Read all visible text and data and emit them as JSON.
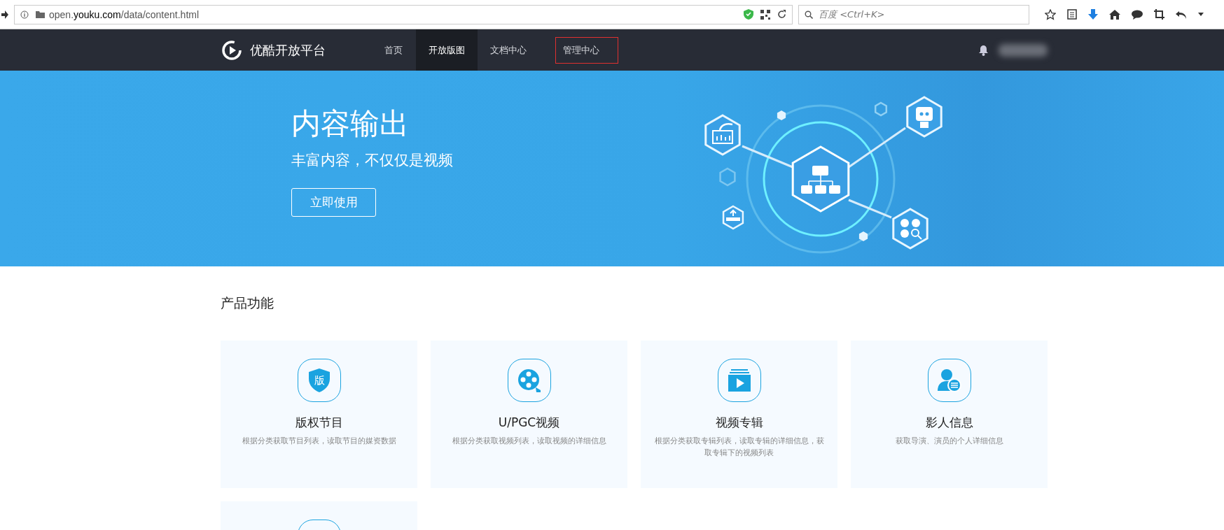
{
  "browser": {
    "url_host_prefix": "open.",
    "url_host": "youku.com",
    "url_path": "/data/content.html",
    "search_placeholder": "百度 <Ctrl+K>"
  },
  "nav": {
    "logo": "优酷开放平台",
    "items": [
      {
        "label": "首页",
        "selected": false,
        "annotated": false
      },
      {
        "label": "开放版图",
        "selected": true,
        "annotated": false
      },
      {
        "label": "文档中心",
        "selected": false,
        "annotated": false
      },
      {
        "label": "管理中心",
        "selected": false,
        "annotated": true
      }
    ]
  },
  "hero": {
    "title": "内容输出",
    "subtitle": "丰富内容，不仅仅是视频",
    "button": "立即使用"
  },
  "section_title": "产品功能",
  "cards": [
    {
      "kind": "shield",
      "icon_text": "版",
      "title": "版权节目",
      "description": "根据分类获取节目列表，读取节目的媒资数据"
    },
    {
      "kind": "film",
      "title": "U/PGC视频",
      "description": "根据分类获取视频列表，读取视频的详细信息"
    },
    {
      "kind": "album",
      "title": "视频专辑",
      "description": "根据分类获取专辑列表，读取专辑的详细信息，获取专辑下的视频列表"
    },
    {
      "kind": "person",
      "title": "影人信息",
      "description": "获取导演、演员的个人详细信息"
    },
    {
      "kind": "blank"
    }
  ]
}
